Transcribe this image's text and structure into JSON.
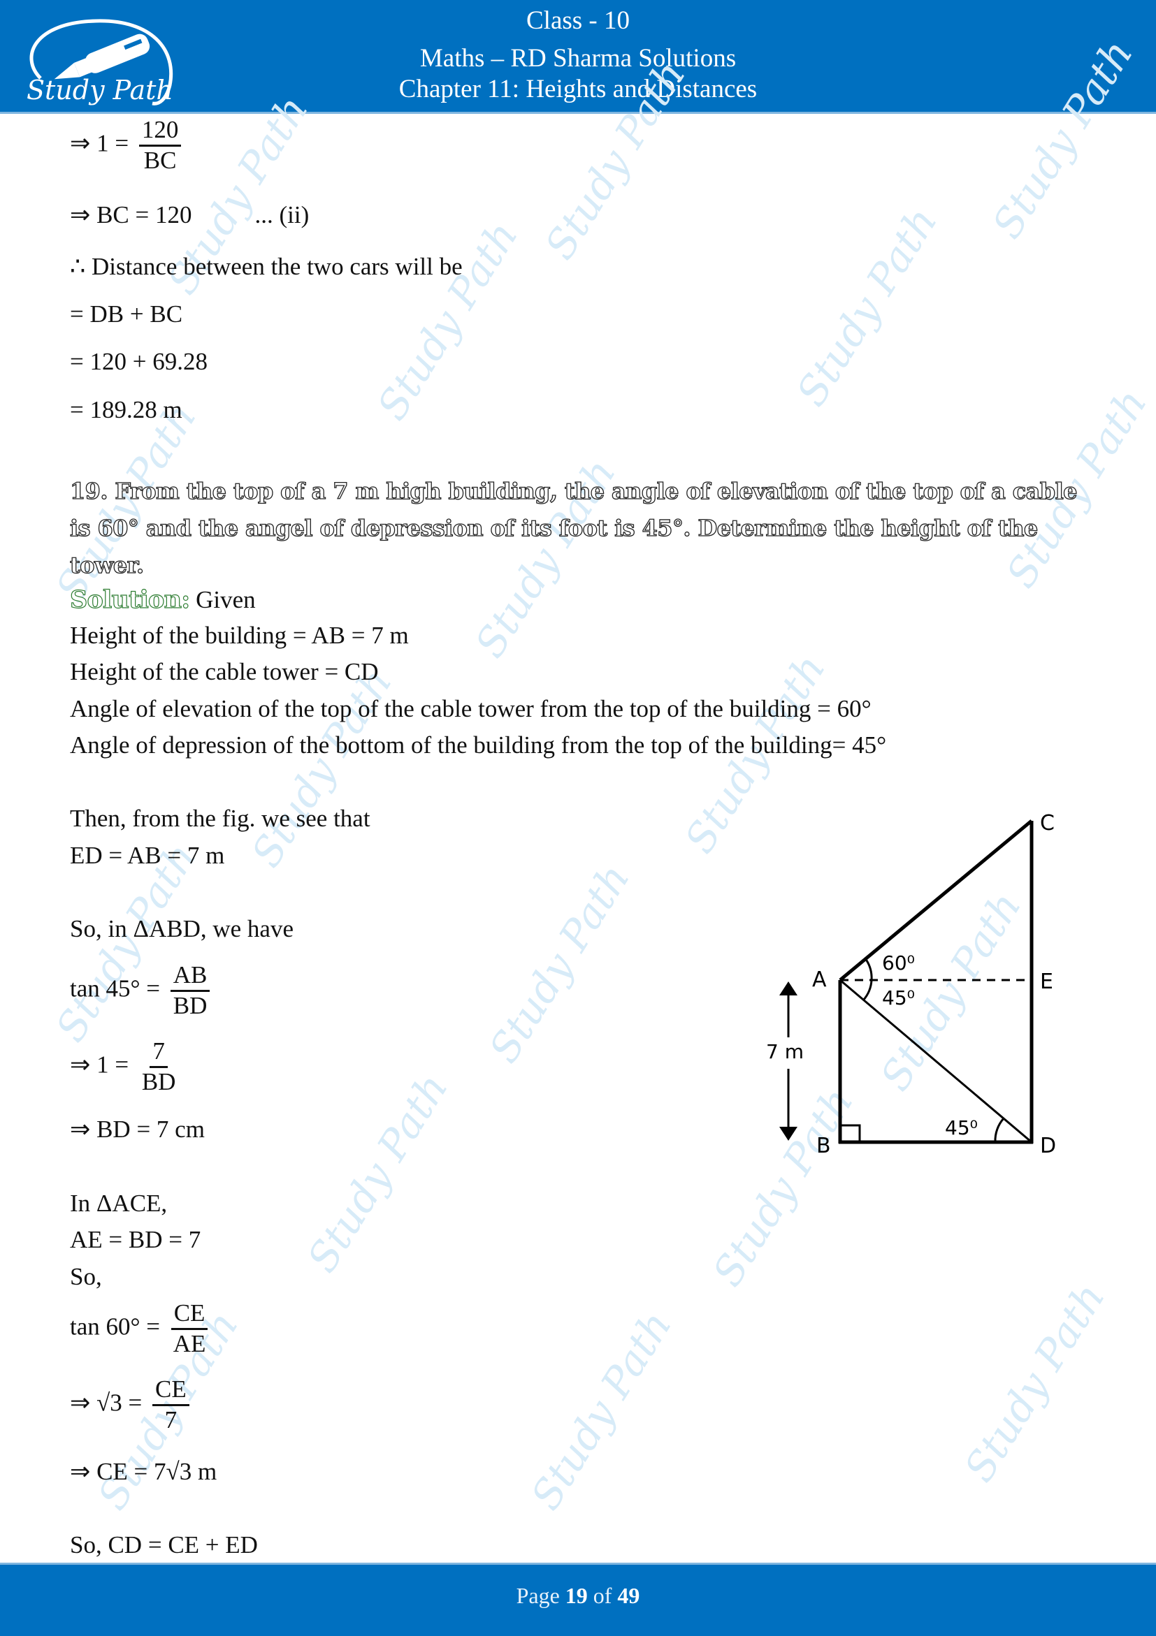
{
  "header": {
    "class_line": "Class - 10",
    "subject_line": "Maths – RD Sharma Solutions",
    "chapter_line": "Chapter 11: Heights and Distances",
    "logo_text": "Study Path",
    "brand_color": "#0070c0"
  },
  "previous_solution": {
    "step1": {
      "prefix": "⇒ 1 =",
      "numerator": "120",
      "denominator": "BC"
    },
    "step2": {
      "text": "⇒ BC = 120",
      "tag": "... (ii)"
    },
    "step3": "∴ Distance between the two cars will be",
    "step4": "= DB + BC",
    "step5": "= 120 + 69.28",
    "step6": "= 189.28 m"
  },
  "question": {
    "number": "19.",
    "line1": "19. From the top of a 7 m high building, the angle of elevation of the top of a cable",
    "line2": "is 60° and the angel of depression of its foot is 45°. Determine the height of the tower."
  },
  "solution": {
    "label": "Solution:",
    "intro": "Given",
    "given": [
      "Height of the building = AB = 7 m",
      "Height of the cable tower = CD",
      "Angle of elevation of the top of the cable tower from the top of the building = 60°",
      "Angle of depression of the bottom of the building from the top of the building= 45°"
    ],
    "from_fig": "Then, from the fig. we see that",
    "ed_eq": "ED = AB = 7 m",
    "abd_intro": "So, in ΔABD, we have",
    "tan45": {
      "prefix": "tan 45° =",
      "numerator": "AB",
      "denominator": "BD"
    },
    "one_eq": {
      "prefix": "⇒ 1 =",
      "numerator": "7",
      "denominator": "BD"
    },
    "bd_result": "⇒ BD = 7 cm",
    "ace_intro": "In ΔACE,",
    "ae_eq": "AE = BD = 7",
    "so": "So,",
    "tan60": {
      "prefix": "tan 60° =",
      "numerator": "CE",
      "denominator": "AE"
    },
    "root3_eq": {
      "prefix": "⇒ √3 =",
      "numerator": "CE",
      "denominator": "7"
    },
    "ce_result": "⇒ CE = 7√3 m",
    "cd_eq": "So, CD = CE + ED"
  },
  "figure": {
    "points": {
      "A": "A",
      "B": "B",
      "C": "C",
      "D": "D",
      "E": "E"
    },
    "angle_elevation": "60⁰",
    "angle_depression": "45⁰",
    "angle_at_d": "45⁰",
    "height_label": "7 m"
  },
  "footer": {
    "page_prefix": "Page",
    "page_current": "19",
    "page_of": "of",
    "page_total": "49"
  },
  "watermark": {
    "text": "Study Path"
  }
}
